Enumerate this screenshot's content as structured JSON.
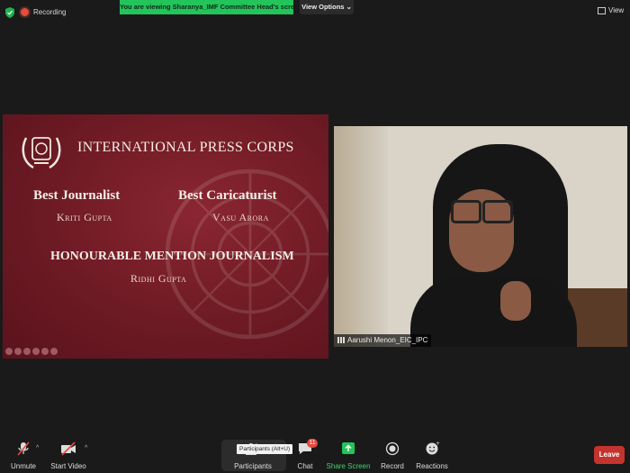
{
  "topbar": {
    "recording_label": "Recording",
    "viewing_banner": "You are viewing Sharanya_IMF Committee Head's screen",
    "view_options_label": "View Options",
    "view_label": "View"
  },
  "slide": {
    "title": "International Press Corps",
    "awards": [
      {
        "heading": "Best Journalist",
        "name": "Kriti Gupta"
      },
      {
        "heading": "Best Caricaturist",
        "name": "Vasu Arora"
      },
      {
        "heading": "Honourable Mention Journalism",
        "name": "Ridhi Gupta"
      }
    ]
  },
  "video": {
    "participant_name": "Aarushi Menon_EIC_IPC"
  },
  "toolbar": {
    "unmute_label": "Unmute",
    "start_video_label": "Start Video",
    "participants_label": "Participants",
    "participants_tooltip": "Participants (Alt+U)",
    "chat_label": "Chat",
    "chat_badge": "11",
    "share_screen_label": "Share Screen",
    "record_label": "Record",
    "reactions_label": "Reactions",
    "leave_label": "Leave"
  },
  "colors": {
    "banner_green": "#23c45a",
    "share_green": "#23c45a",
    "slide_maroon": "#6d1a24",
    "leave_red": "#c5332f",
    "badge_red": "#e5493c"
  }
}
